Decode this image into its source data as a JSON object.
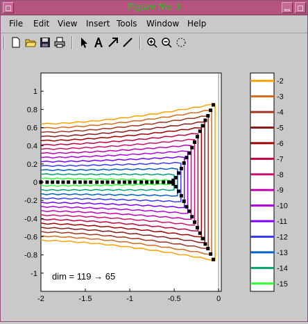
{
  "window": {
    "title": "Figure No. 3"
  },
  "menu": [
    "File",
    "Edit",
    "View",
    "Insert",
    "Tools",
    "Window",
    "Help"
  ],
  "toolbar_icons": [
    "new-file-icon",
    "open-folder-icon",
    "save-icon",
    "print-icon",
    "select-arrow-icon",
    "insert-text-icon",
    "insert-arrow-icon",
    "insert-line-icon",
    "zoom-in-icon",
    "zoom-out-icon",
    "rotate-icon"
  ],
  "chart_data": [
    {
      "type": "line",
      "title": "",
      "xlabel": "",
      "ylabel": "",
      "xlim": [
        -2,
        0.03
      ],
      "ylim": [
        -1.2,
        1.2
      ],
      "x_ticks": [
        "-2",
        "-1.5",
        "-1",
        "-0.5",
        "0"
      ],
      "y_ticks": [
        "1",
        "0.8",
        "0.6",
        "0.4",
        "0.2",
        "0",
        "-0.2",
        "-0.4",
        "-0.6",
        "-0.8",
        "-1"
      ],
      "annotation": "dim = 119 → 65",
      "contour_levels": [
        -2,
        -3,
        -4,
        -5,
        -6,
        -7,
        -8,
        -9,
        -10,
        -11,
        -12,
        -13,
        -14,
        -15
      ],
      "colors": [
        "#ffa000",
        "#d2691e",
        "#a0341e",
        "#8b1a1a",
        "#a00000",
        "#c0003c",
        "#d0106e",
        "#c000b0",
        "#b000e0",
        "#7a00ff",
        "#3a3aff",
        "#0060c8",
        "#00a070",
        "#30ff30"
      ],
      "eigenvalues_upper": [
        [
          -0.06,
          0.85
        ],
        [
          -0.09,
          0.79
        ],
        [
          -0.12,
          0.73
        ],
        [
          -0.15,
          0.68
        ],
        [
          -0.18,
          0.62
        ],
        [
          -0.21,
          0.56
        ],
        [
          -0.24,
          0.5
        ],
        [
          -0.27,
          0.44
        ],
        [
          -0.3,
          0.38
        ],
        [
          -0.33,
          0.32
        ],
        [
          -0.36,
          0.27
        ],
        [
          -0.39,
          0.21
        ],
        [
          -0.42,
          0.15
        ],
        [
          -0.45,
          0.1
        ],
        [
          -0.48,
          0.05
        ],
        [
          -0.51,
          0.02
        ]
      ],
      "eigenvalues_real": [
        -2.0,
        -1.93,
        -1.87,
        -1.81,
        -1.75,
        -1.69,
        -1.62,
        -1.56,
        -1.5,
        -1.44,
        -1.37,
        -1.31,
        -1.25,
        -1.19,
        -1.12,
        -1.06,
        -1.0,
        -0.94,
        -0.87,
        -0.81,
        -0.75,
        -0.69,
        -0.62,
        -0.56,
        -0.52
      ]
    },
    {
      "type": "heatmap",
      "title": "",
      "legend": "colorbar",
      "levels": [
        "-2",
        "-3",
        "-4",
        "-5",
        "-6",
        "-7",
        "-8",
        "-9",
        "-10",
        "-11",
        "-12",
        "-13",
        "-14",
        "-15"
      ],
      "colors": [
        "#ffa000",
        "#d2691e",
        "#a0341e",
        "#8b1a1a",
        "#a00000",
        "#c0003c",
        "#d0106e",
        "#c000b0",
        "#b000e0",
        "#7a00ff",
        "#3a3aff",
        "#0060c8",
        "#00a070",
        "#30ff30"
      ]
    }
  ]
}
